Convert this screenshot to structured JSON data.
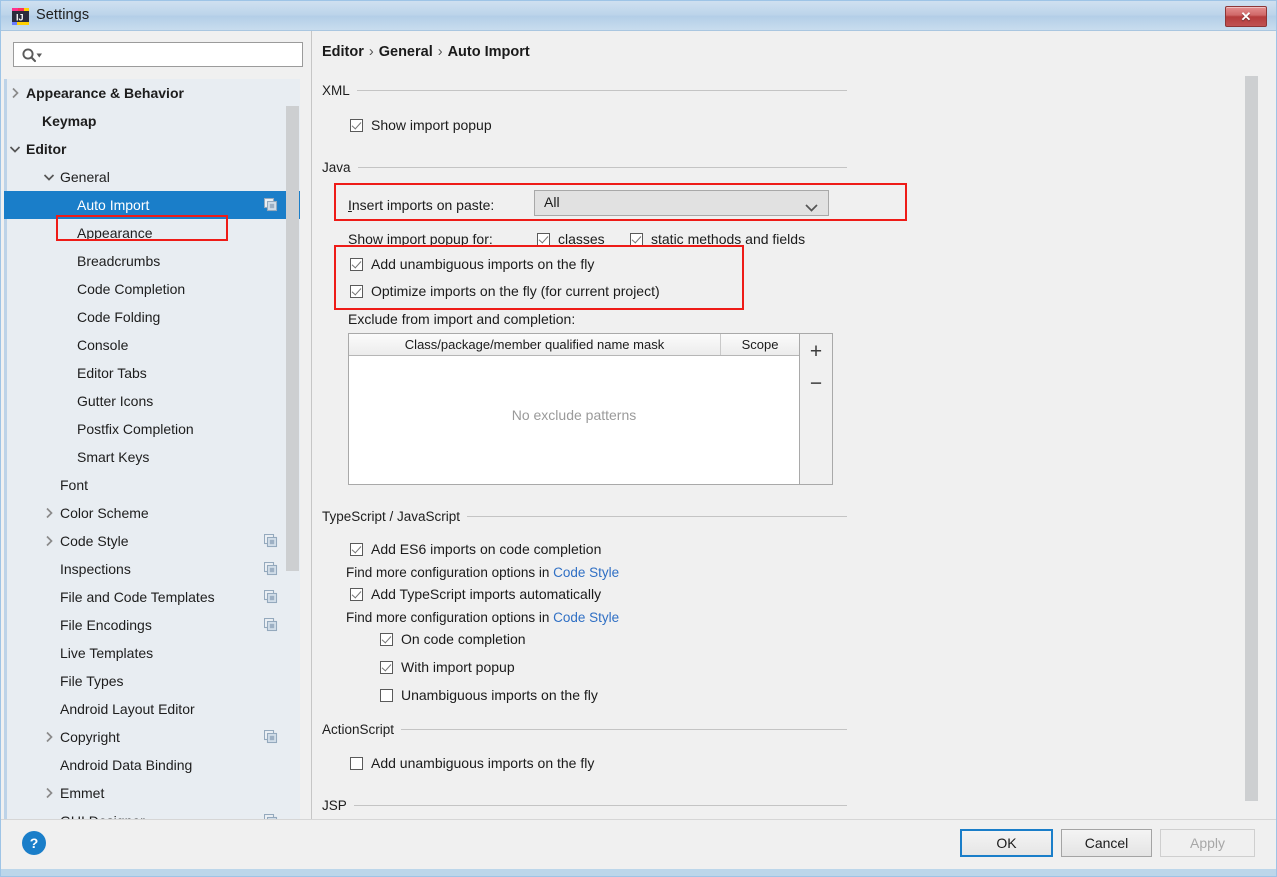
{
  "window": {
    "title": "Settings",
    "app_icon": "intellij-idea-icon",
    "close_label": "✕"
  },
  "search": {
    "value": "",
    "placeholder": "",
    "icon": "search-icon"
  },
  "sidebar": {
    "items": [
      {
        "label": "Appearance & Behavior",
        "indent": 22,
        "arrow": "collapsed",
        "bold": true,
        "selected": false,
        "dup_icon": false
      },
      {
        "label": "Keymap",
        "indent": 38,
        "arrow": "none",
        "bold": true,
        "selected": false,
        "dup_icon": false
      },
      {
        "label": "Editor",
        "indent": 22,
        "arrow": "expanded",
        "bold": true,
        "selected": false,
        "dup_icon": false
      },
      {
        "label": "General",
        "indent": 56,
        "arrow": "expanded",
        "bold": false,
        "selected": false,
        "dup_icon": false
      },
      {
        "label": "Auto Import",
        "indent": 73,
        "arrow": "none",
        "bold": false,
        "selected": true,
        "dup_icon": true
      },
      {
        "label": "Appearance",
        "indent": 73,
        "arrow": "none",
        "bold": false,
        "selected": false,
        "dup_icon": false
      },
      {
        "label": "Breadcrumbs",
        "indent": 73,
        "arrow": "none",
        "bold": false,
        "selected": false,
        "dup_icon": false
      },
      {
        "label": "Code Completion",
        "indent": 73,
        "arrow": "none",
        "bold": false,
        "selected": false,
        "dup_icon": false
      },
      {
        "label": "Code Folding",
        "indent": 73,
        "arrow": "none",
        "bold": false,
        "selected": false,
        "dup_icon": false
      },
      {
        "label": "Console",
        "indent": 73,
        "arrow": "none",
        "bold": false,
        "selected": false,
        "dup_icon": false
      },
      {
        "label": "Editor Tabs",
        "indent": 73,
        "arrow": "none",
        "bold": false,
        "selected": false,
        "dup_icon": false
      },
      {
        "label": "Gutter Icons",
        "indent": 73,
        "arrow": "none",
        "bold": false,
        "selected": false,
        "dup_icon": false
      },
      {
        "label": "Postfix Completion",
        "indent": 73,
        "arrow": "none",
        "bold": false,
        "selected": false,
        "dup_icon": false
      },
      {
        "label": "Smart Keys",
        "indent": 73,
        "arrow": "none",
        "bold": false,
        "selected": false,
        "dup_icon": false
      },
      {
        "label": "Font",
        "indent": 56,
        "arrow": "none",
        "bold": false,
        "selected": false,
        "dup_icon": false
      },
      {
        "label": "Color Scheme",
        "indent": 56,
        "arrow": "collapsed",
        "bold": false,
        "selected": false,
        "dup_icon": false
      },
      {
        "label": "Code Style",
        "indent": 56,
        "arrow": "collapsed",
        "bold": false,
        "selected": false,
        "dup_icon": true
      },
      {
        "label": "Inspections",
        "indent": 56,
        "arrow": "none",
        "bold": false,
        "selected": false,
        "dup_icon": true
      },
      {
        "label": "File and Code Templates",
        "indent": 56,
        "arrow": "none",
        "bold": false,
        "selected": false,
        "dup_icon": true
      },
      {
        "label": "File Encodings",
        "indent": 56,
        "arrow": "none",
        "bold": false,
        "selected": false,
        "dup_icon": true
      },
      {
        "label": "Live Templates",
        "indent": 56,
        "arrow": "none",
        "bold": false,
        "selected": false,
        "dup_icon": false
      },
      {
        "label": "File Types",
        "indent": 56,
        "arrow": "none",
        "bold": false,
        "selected": false,
        "dup_icon": false
      },
      {
        "label": "Android Layout Editor",
        "indent": 56,
        "arrow": "none",
        "bold": false,
        "selected": false,
        "dup_icon": false
      },
      {
        "label": "Copyright",
        "indent": 56,
        "arrow": "collapsed",
        "bold": false,
        "selected": false,
        "dup_icon": true
      },
      {
        "label": "Android Data Binding",
        "indent": 56,
        "arrow": "none",
        "bold": false,
        "selected": false,
        "dup_icon": false
      },
      {
        "label": "Emmet",
        "indent": 56,
        "arrow": "collapsed",
        "bold": false,
        "selected": false,
        "dup_icon": false
      },
      {
        "label": "GUI Designer",
        "indent": 56,
        "arrow": "none",
        "bold": false,
        "selected": false,
        "dup_icon": true
      }
    ]
  },
  "breadcrumb": {
    "part1": "Editor",
    "sep1": "›",
    "part2": "General",
    "sep2": "›",
    "part3": "Auto Import"
  },
  "sections": {
    "xml": {
      "title": "XML",
      "show_import_popup": {
        "label": "Show import popup",
        "checked": true
      }
    },
    "java": {
      "title": "Java",
      "insert_imports_label_mnemonic": "I",
      "insert_imports_label_rest": "nsert imports on paste:",
      "insert_imports_value": "All",
      "show_import_popup_for_label": "Show import popup for:",
      "classes": {
        "mnemonic": "c",
        "rest": "lasses",
        "checked": true
      },
      "static_methods": {
        "mnemonic": "s",
        "rest": "tatic methods and fields",
        "checked": true
      },
      "add_unambiguous": {
        "label": "Add unambiguous imports on the fly",
        "checked": true
      },
      "optimize_imports": {
        "label": "Optimize imports on the fly (for current project)",
        "checked": true
      },
      "exclude_label": "Exclude from import and completion:",
      "table": {
        "columns": [
          "Class/package/member qualified name mask",
          "Scope"
        ],
        "rows": [],
        "empty_text": "No exclude patterns",
        "add_button": "+",
        "remove_button": "−"
      }
    },
    "ts_js": {
      "title": "TypeScript / JavaScript",
      "add_es6": {
        "label": "Add ES6 imports on code completion",
        "checked": true
      },
      "hint1_prefix": "Find more configuration options in ",
      "hint1_link": "Code Style",
      "add_ts": {
        "label": "Add TypeScript imports automatically",
        "checked": true
      },
      "hint2_prefix": "Find more configuration options in ",
      "hint2_link": "Code Style",
      "on_code_completion": {
        "label": "On code completion",
        "checked": true
      },
      "with_import_popup": {
        "label": "With import popup",
        "checked": true
      },
      "unambiguous_fly": {
        "label": "Unambiguous imports on the fly",
        "checked": false
      }
    },
    "actionscript": {
      "title": "ActionScript",
      "add_unambiguous": {
        "label": "Add unambiguous imports on the fly",
        "checked": false
      }
    },
    "jsp": {
      "title": "JSP"
    }
  },
  "footer": {
    "help": "?",
    "ok": "OK",
    "cancel": "Cancel",
    "apply": "Apply"
  },
  "colors": {
    "accent_blue": "#1a7ec9",
    "annotation_red": "#ee1b17",
    "link_blue": "#2f6fc4",
    "panel_bg": "#f0f0f0",
    "tree_bg": "#e8edf2",
    "titlebar_blue": "#bcd4ea"
  }
}
